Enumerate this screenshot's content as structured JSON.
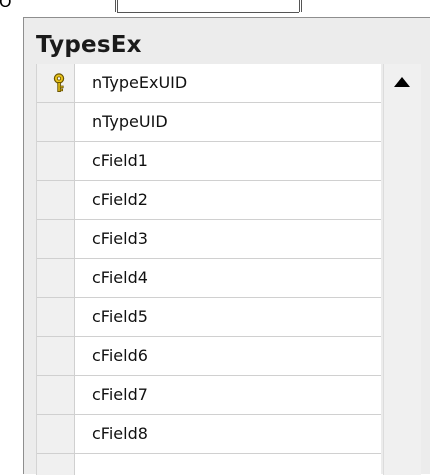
{
  "background_fragment": {
    "letter": "O"
  },
  "table": {
    "title": "TypesEx",
    "fields": [
      {
        "name": "nTypeExUID",
        "primary_key": true
      },
      {
        "name": "nTypeUID",
        "primary_key": false
      },
      {
        "name": "cField1",
        "primary_key": false
      },
      {
        "name": "cField2",
        "primary_key": false
      },
      {
        "name": "cField3",
        "primary_key": false
      },
      {
        "name": "cField4",
        "primary_key": false
      },
      {
        "name": "cField5",
        "primary_key": false
      },
      {
        "name": "cField6",
        "primary_key": false
      },
      {
        "name": "cField7",
        "primary_key": false
      },
      {
        "name": "cField8",
        "primary_key": false
      },
      {
        "name": "",
        "primary_key": false
      }
    ]
  },
  "icons": {
    "primary_key": "key-icon",
    "scroll_up": "triangle-up-icon"
  },
  "colors": {
    "window_background": "#ececec",
    "key_gold": "#e8c21a"
  }
}
